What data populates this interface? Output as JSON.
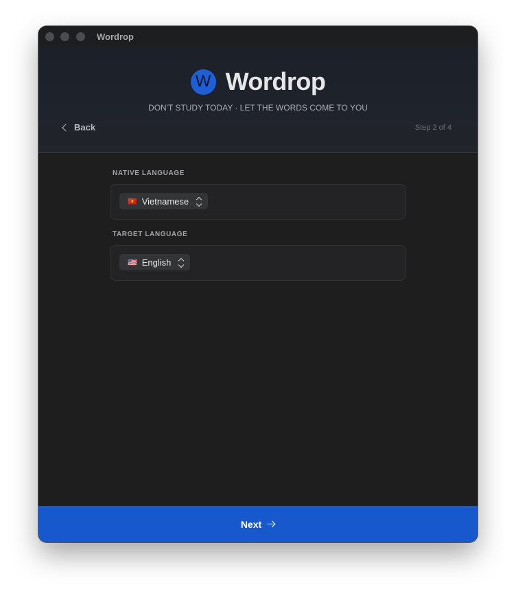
{
  "window": {
    "title": "Wordrop"
  },
  "header": {
    "logo_letter": "W",
    "app_name": "Wordrop",
    "tagline": "DON'T STUDY TODAY · LET THE WORDS COME TO YOU",
    "back_label": "Back",
    "step_text": "Step 2 of 4"
  },
  "form": {
    "native": {
      "label": "NATIVE LANGUAGE",
      "flag": "🇻🇳",
      "value": "Vietnamese"
    },
    "target": {
      "label": "TARGET LANGUAGE",
      "flag": "🇺🇸",
      "value": "English"
    }
  },
  "footer": {
    "next_label": "Next"
  },
  "colors": {
    "accent": "#1758cc",
    "logo": "#1e5fd6",
    "background": "#1e1e1f"
  },
  "icons": {
    "back": "chevron-left-icon",
    "select": "chevron-up-down-icon",
    "next": "arrow-right-icon"
  }
}
